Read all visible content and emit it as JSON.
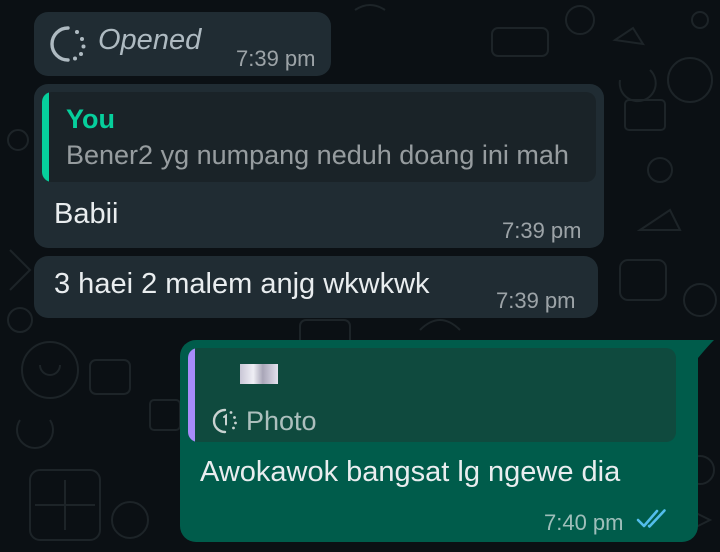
{
  "colors": {
    "background": "#0b1014",
    "incoming_bubble": "#202c33",
    "outgoing_bubble": "#005c4b",
    "you_accent": "#06cf9c",
    "quote_accent_purple": "#a78bfa",
    "read_ticks": "#53bdeb"
  },
  "messages": [
    {
      "type": "view-once-status",
      "status": "Opened",
      "time": "7:39 pm",
      "icon": "view-once-icon"
    },
    {
      "type": "reply",
      "quote_author": "You",
      "quote_text": "Bener2 yg numpang neduh doang ini mah",
      "text": "Babii",
      "time": "7:39 pm"
    },
    {
      "type": "text",
      "text": "3 haei 2 malem anjg wkwkwk",
      "time": "7:39 pm"
    },
    {
      "type": "reply-outgoing",
      "quote_media": "Photo",
      "quote_icon": "view-once-icon",
      "text": "Awokawok bangsat lg ngewe dia",
      "time": "7:40 pm",
      "status_icon": "double-check-icon"
    }
  ]
}
